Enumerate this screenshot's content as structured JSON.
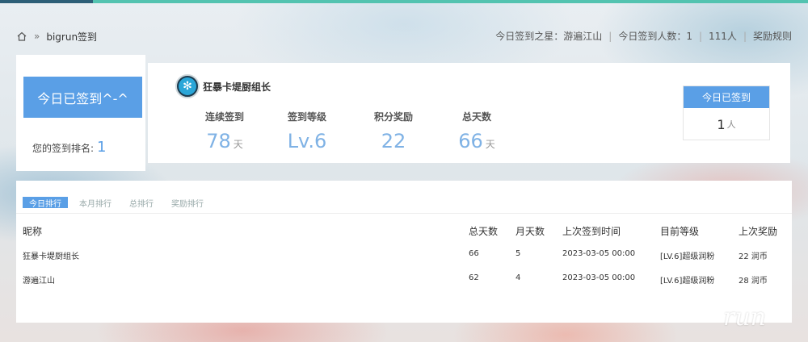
{
  "breadcrumb": {
    "page": "bigrun签到"
  },
  "toplinks": {
    "star": "今日签到之星：游遍江山",
    "stats": "今日签到人数：1",
    "total": "111人",
    "rules": "奖励规则"
  },
  "status": {
    "button": "今日已签到^-^",
    "rank_label": "您的签到排名:",
    "rank_value": "1"
  },
  "user": {
    "name": "狂暴卡堤厨组长",
    "avatar_icon": "snowflake-icon"
  },
  "stats": {
    "streak": {
      "label": "连续签到",
      "value": "78",
      "unit": "天"
    },
    "level": {
      "label": "签到等级",
      "value": "Lv.6"
    },
    "points": {
      "label": "积分奖励",
      "value": "22"
    },
    "total": {
      "label": "总天数",
      "value": "66",
      "unit": "天"
    }
  },
  "today": {
    "label": "今日已签到",
    "value": "1",
    "unit": "人"
  },
  "tabs": [
    "今日排行",
    "本月排行",
    "总排行",
    "奖励排行"
  ],
  "table": {
    "headers": [
      "昵称",
      "总天数",
      "月天数",
      "上次签到时间",
      "目前等级",
      "上次奖励"
    ],
    "rows": [
      [
        "狂暴卡堤厨组长",
        "66",
        "5",
        "2023-03-05 00:00",
        "[LV.6]超级润粉",
        "22 润币"
      ],
      [
        "游遍江山",
        "62",
        "4",
        "2023-03-05 00:00",
        "[LV.6]超级润粉",
        "28 润币"
      ]
    ]
  },
  "watermark": "run",
  "colors": {
    "accent": "#5a9fe6",
    "topbar": "#53c3b0",
    "value": "#7fb2e5"
  }
}
